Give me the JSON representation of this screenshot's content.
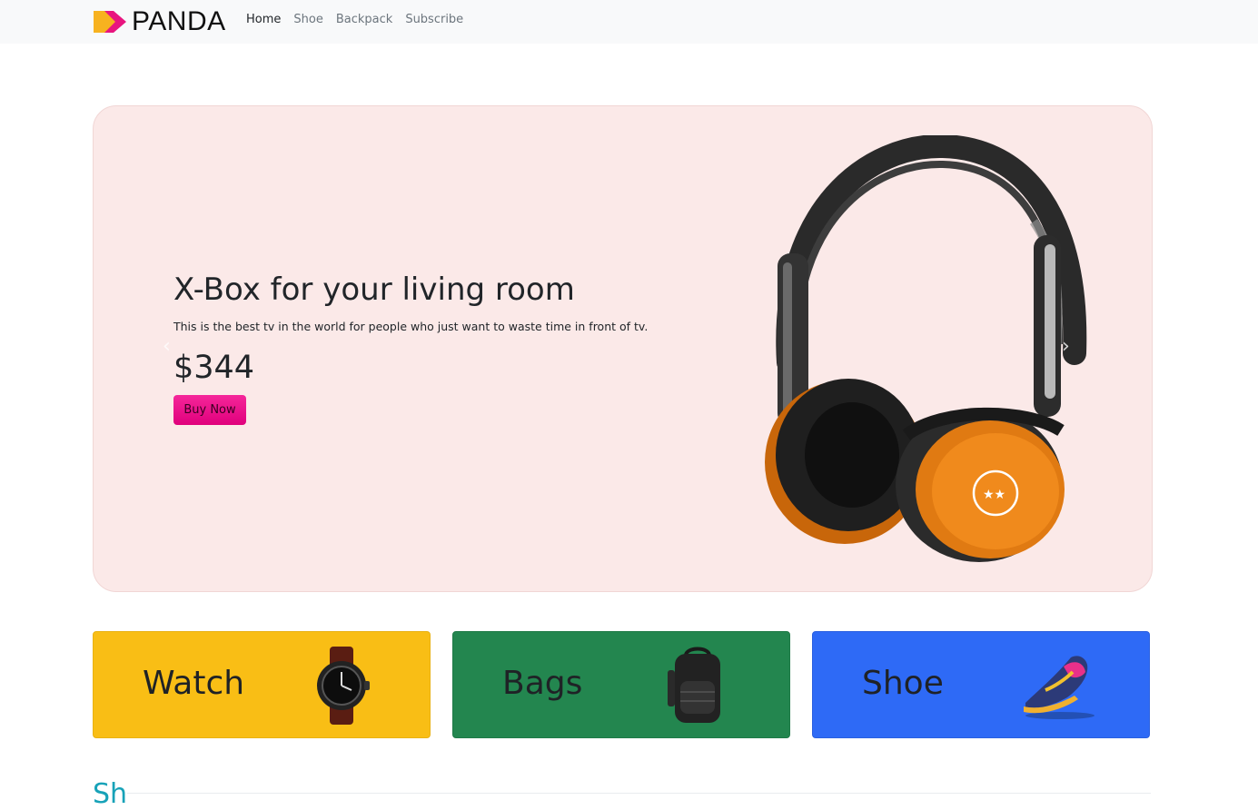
{
  "brand": {
    "name": "PANDA"
  },
  "nav": {
    "items": [
      "Home",
      "Shoe",
      "Backpack",
      "Subscribe"
    ],
    "active": "Home"
  },
  "hero": {
    "title": "X-Box for your living room",
    "description": "This is the best tv in the world for people who just want to waste time in front of tv.",
    "price": "$344",
    "button_label": "Buy Now",
    "image": "headphones"
  },
  "categories": [
    {
      "label": "Watch",
      "color": "#f9be15",
      "image": "wristwatch"
    },
    {
      "label": "Bags",
      "color": "#23864f",
      "image": "backpack"
    },
    {
      "label": "Shoe",
      "color": "#2e6af6",
      "image": "sneaker"
    }
  ],
  "next_section": {
    "heading_peek": "Sh"
  },
  "colors": {
    "accent": "#e0007c",
    "hero_bg": "#fbe9e8",
    "navbar_bg": "#f8f9fa"
  }
}
